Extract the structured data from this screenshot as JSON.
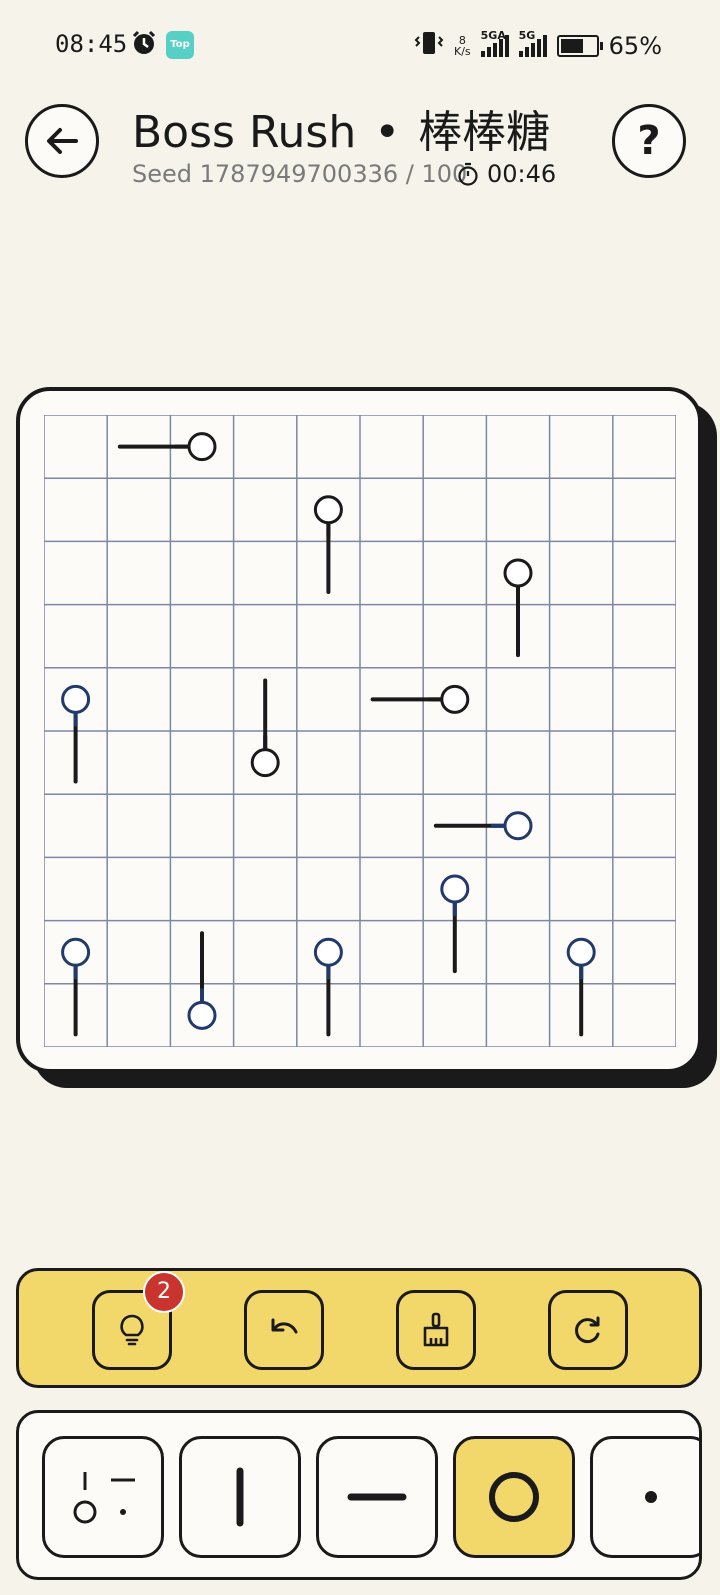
{
  "status_bar": {
    "time": "08:45",
    "app_badge": "Top",
    "net_speed_value": "8",
    "net_speed_unit": "K/s",
    "sig1_label": "5GA",
    "sig2_label": "5G",
    "battery": "65%",
    "battery_level": 0.65
  },
  "header": {
    "title_main": "Boss Rush",
    "title_sep": "•",
    "title_cn": "棒棒糖",
    "seed": "Seed 1787949700336 / 100",
    "timer": "00:46",
    "help_label": "?"
  },
  "board": {
    "rows": 10,
    "cols": 10,
    "colors": {
      "grid": "#7d87a6",
      "dark": "#1a1a1a",
      "blue": "#213a6b"
    },
    "lollipops": [
      {
        "row": 0,
        "col": 2,
        "dir": "left",
        "color": "dark"
      },
      {
        "row": 1,
        "col": 4,
        "dir": "down",
        "color": "dark"
      },
      {
        "row": 2,
        "col": 7,
        "dir": "down",
        "color": "dark"
      },
      {
        "row": 4,
        "col": 0,
        "dir": "down",
        "color": "blue"
      },
      {
        "row": 5,
        "col": 3,
        "dir": "up",
        "color": "dark"
      },
      {
        "row": 4,
        "col": 6,
        "dir": "left",
        "color": "dark"
      },
      {
        "row": 6,
        "col": 7,
        "dir": "left",
        "color": "blue"
      },
      {
        "row": 7,
        "col": 6,
        "dir": "down",
        "color": "blue"
      },
      {
        "row": 8,
        "col": 0,
        "dir": "down",
        "color": "blue"
      },
      {
        "row": 9,
        "col": 2,
        "dir": "up",
        "color": "blue"
      },
      {
        "row": 8,
        "col": 4,
        "dir": "down",
        "color": "blue"
      },
      {
        "row": 8,
        "col": 8,
        "dir": "down",
        "color": "blue"
      }
    ]
  },
  "toolbar": {
    "hint_icon": "lightbulb-icon",
    "hint_count": "2",
    "undo_icon": "undo-icon",
    "clear_icon": "broom-icon",
    "restart_icon": "restart-icon"
  },
  "palette": {
    "items": [
      "mixed-pieces-icon",
      "vertical-line-icon",
      "horizontal-line-icon",
      "circle-icon",
      "dot-icon"
    ],
    "selected_index": 3
  }
}
